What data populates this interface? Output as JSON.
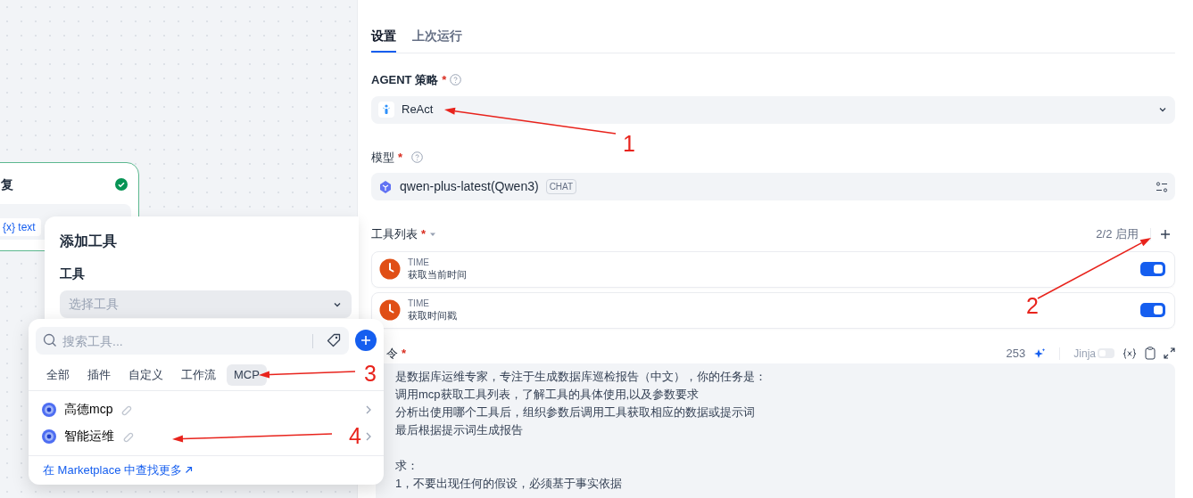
{
  "canvas": {
    "node": {
      "title": "复",
      "variable": "{x} text"
    }
  },
  "add_tool": {
    "title": "添加工具",
    "field_label": "工具",
    "select_placeholder": "选择工具"
  },
  "tool_picker": {
    "search_placeholder": "搜索工具...",
    "tabs": [
      {
        "label": "全部",
        "selected": false
      },
      {
        "label": "插件",
        "selected": false
      },
      {
        "label": "自定义",
        "selected": false
      },
      {
        "label": "工作流",
        "selected": false
      },
      {
        "label": "MCP",
        "selected": true
      }
    ],
    "items": [
      {
        "name": "高德mcp"
      },
      {
        "name": "智能运维"
      }
    ],
    "marketplace_link": "在 Marketplace 中查找更多"
  },
  "panel": {
    "tabs": [
      {
        "label": "设置",
        "selected": true
      },
      {
        "label": "上次运行",
        "selected": false
      }
    ],
    "agent_strategy": {
      "label": "AGENT 策略",
      "required_mark": "*",
      "value": "ReAct"
    },
    "model": {
      "label": "模型",
      "required_mark": "*",
      "value": "qwen-plus-latest(Qwen3)",
      "tag": "CHAT"
    },
    "tools": {
      "label": "工具列表",
      "required_mark": "*",
      "count": "2/2 启用",
      "items": [
        {
          "provider": "TIME",
          "name": "获取当前时间",
          "on": true
        },
        {
          "provider": "TIME",
          "name": "获取时间戳",
          "on": true
        }
      ]
    },
    "instruction": {
      "label": "令",
      "required_mark": "*",
      "char_count": "253",
      "jinja_label": "Jinja",
      "jinja_on": false,
      "paragraphs": [
        [
          "是数据库运维专家，专注于生成数据库巡检报告（中文），你的任务是：",
          "调用mcp获取工具列表，了解工具的具体使用,以及参数要求",
          "分析出使用哪个工具后，组织参数后调用工具获取相应的数据或提示词",
          "最后根据提示词生成报告"
        ],
        [
          "求：",
          "1，不要出现任何的假设，必须基于事实依据"
        ]
      ]
    }
  },
  "annotations": [
    {
      "label": "1"
    },
    {
      "label": "2"
    },
    {
      "label": "3"
    },
    {
      "label": "4"
    }
  ]
}
